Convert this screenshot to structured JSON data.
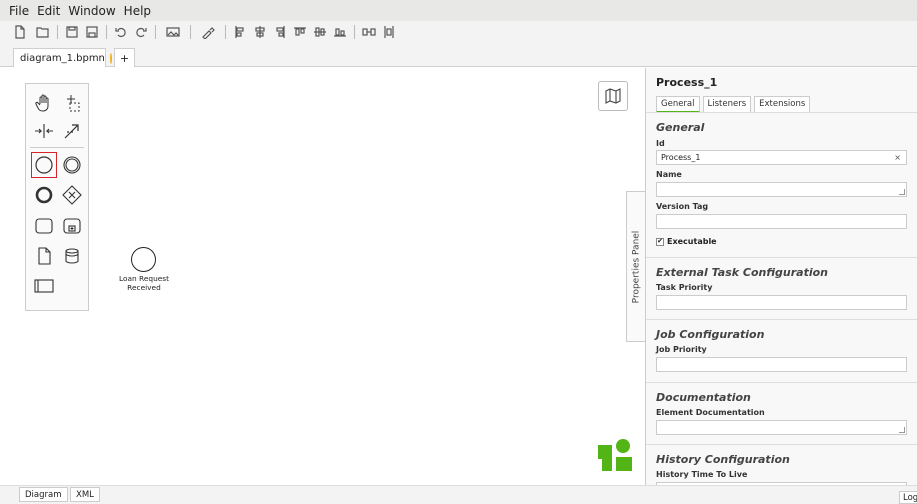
{
  "menu": [
    "File",
    "Edit",
    "Window",
    "Help"
  ],
  "tabs": {
    "file_tab": "diagram_1.bpmn",
    "add_tab": "+"
  },
  "canvas": {
    "event_label": "Loan Request Received"
  },
  "props_toggle": "Properties Panel",
  "properties": {
    "title": "Process_1",
    "tabs": [
      "General",
      "Listeners",
      "Extensions"
    ],
    "general": {
      "heading": "General",
      "id_label": "Id",
      "id_value": "Process_1",
      "clear": "×",
      "name_label": "Name",
      "name_value": "",
      "version_label": "Version Tag",
      "version_value": "",
      "executable_label": "Executable",
      "checkmark": "✔"
    },
    "external": {
      "heading": "External Task Configuration",
      "label": "Task Priority"
    },
    "job": {
      "heading": "Job Configuration",
      "label": "Job Priority"
    },
    "documentation": {
      "heading": "Documentation",
      "label": "Element Documentation"
    },
    "history": {
      "heading": "History Configuration",
      "label": "History Time To Live"
    }
  },
  "bottom_tabs": [
    "Diagram",
    "XML"
  ],
  "log_button": "Log",
  "colors": {
    "accent": "#52b415",
    "selected_tool": "#d6242a",
    "dirty_indicator": "#f2b01e"
  }
}
